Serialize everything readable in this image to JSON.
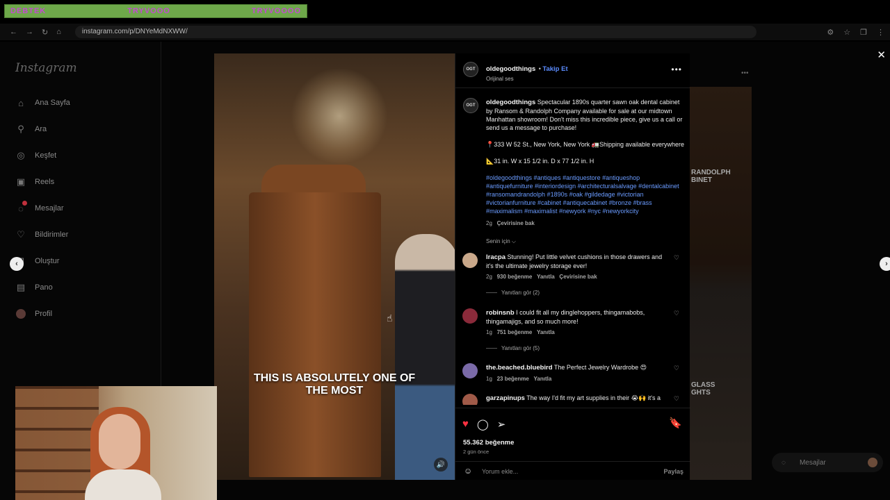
{
  "banner": {
    "left": "DEBTEK",
    "middle": "TRYVOOO",
    "right": "TRYVOOOO"
  },
  "browser": {
    "url": "instagram.com/p/DNYeMdNXWW/"
  },
  "sidebar": {
    "logo": "Instagram",
    "items": [
      {
        "label": "Ana Sayfa",
        "icon": "home-icon"
      },
      {
        "label": "Ara",
        "icon": "search-icon"
      },
      {
        "label": "Keşfet",
        "icon": "compass-icon"
      },
      {
        "label": "Reels",
        "icon": "reels-icon"
      },
      {
        "label": "Mesajlar",
        "icon": "messenger-icon"
      },
      {
        "label": "Bildirimler",
        "icon": "heart-icon"
      },
      {
        "label": "Oluştur",
        "icon": "plus-icon"
      },
      {
        "label": "Pano",
        "icon": "dashboard-icon"
      },
      {
        "label": "Profil",
        "icon": "avatar"
      }
    ]
  },
  "media": {
    "caption_line1": "THIS IS ABSOLUTELY ONE OF",
    "caption_line2": "THE MOST"
  },
  "post": {
    "username": "oldegoodthings",
    "avatar_text": "OGT",
    "follow_label": "Takip Et",
    "audio": "Orijinal ses",
    "description": "Spectacular 1890s quarter sawn oak dental cabinet by Ransom & Randolph Company available for sale at our midtown Manhattan showroom! Don't miss this incredible piece, give us a call or send us a message to purchase!",
    "address": "📍333 W 52 St., New York, New York 🚛Shipping available everywhere",
    "dimensions": "📐31 in. W x 15 1/2 in. D x 77 1/2 in. H",
    "hashtags": "#oldegoodthings #antiques #antiquestore #antiqueshop #antiquefurniture #interiordesign #architecturalsalvage #dentalcabinet #ransomandrandolph #1890s #oak #gildedage #victorian #victorianfurniture #cabinet #antiquecabinet #bronze #brass #maximalism #maximalist #newyork #nyc #newyorkcity",
    "desc_time": "2g",
    "translate": "Çevirisine bak",
    "sort": "Senin için ⌵"
  },
  "comments": [
    {
      "user": "lracpa",
      "text": "Stunning! Put little velvet cushions in those drawers and it's the ultimate jewelry storage ever!",
      "time": "2g",
      "likes": "930 beğenme",
      "reply": "Yanıtla",
      "extra": "Çevirisine bak",
      "replies": "Yanıtları gör (2)"
    },
    {
      "user": "robinsnb",
      "text": "I could fit all my dinglehoppers, thingamabobs, thingamajigs, and so much more!",
      "time": "1g",
      "likes": "751 beğenme",
      "reply": "Yanıtla",
      "extra": "",
      "replies": "Yanıtları gör (5)"
    },
    {
      "user": "the.beached.bluebird",
      "text": "The Perfect Jewelry Wardrobe 😍",
      "time": "1g",
      "likes": "23 beğenme",
      "reply": "Yanıtla",
      "extra": "",
      "replies": ""
    },
    {
      "user": "garzapinups",
      "text": "The way I'd fit my art supplies in their 😭🙌 it's a",
      "time": "",
      "likes": "",
      "reply": "",
      "extra": "",
      "replies": ""
    }
  ],
  "actions": {
    "likes": "55.362 beğenme",
    "date": "2 gün önce",
    "comment_placeholder": "Yorum ekle...",
    "share": "Paylaş"
  },
  "preview": {
    "text1a": "RANDOLPH",
    "text1b": "BINET",
    "text2a": "GLASS",
    "text2b": "GHTS"
  },
  "messages_pill": "Mesajlar",
  "colors": {
    "like": "#ff3040",
    "link": "#6a9bff",
    "follow": "#5b8cff"
  }
}
